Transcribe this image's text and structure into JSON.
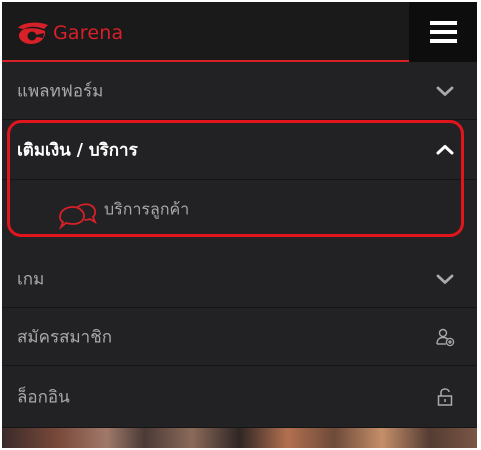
{
  "brand": {
    "name": "Garena",
    "logo_icon": "garena-logo-icon"
  },
  "header": {
    "menu_icon": "hamburger-menu-icon"
  },
  "menu": [
    {
      "label": "แพลทฟอร์ม",
      "icon": "chevron-down-icon",
      "expanded": false
    },
    {
      "label": "เติมเงิน / บริการ",
      "icon": "chevron-up-icon",
      "expanded": true,
      "children": [
        {
          "label": "บริการลูกค้า",
          "icon": "chat-bubbles-icon"
        }
      ]
    },
    {
      "label": "เกม",
      "icon": "chevron-down-icon",
      "expanded": false
    },
    {
      "label": "สมัครสมาชิก",
      "icon": "add-user-icon"
    },
    {
      "label": "ล็อกอิน",
      "icon": "unlock-icon"
    }
  ],
  "colors": {
    "accent": "#d72028",
    "highlight": "#e2151d",
    "panel": "#222224",
    "header": "#1a1a1b",
    "text": "#a9a9ac"
  }
}
